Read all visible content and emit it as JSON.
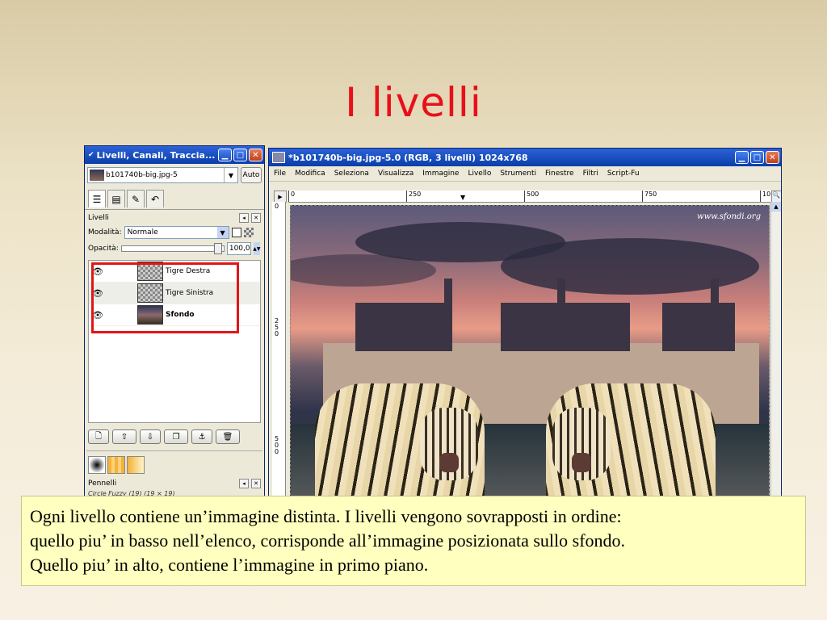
{
  "slide": {
    "title": "I livelli",
    "caption_lines": [
      "Ogni livello contiene un’immagine distinta. I livelli vengono sovrapposti in ordine:",
      "quello piu’ in basso nell’elenco, corrisponde all’immagine posizionata sullo sfondo.",
      "Quello piu’ in alto, contiene l’immagine in primo piano."
    ]
  },
  "dock": {
    "title": "Livelli, Canali, Traccia...",
    "image_select": "b101740b-big.jpg-5",
    "auto_label": "Auto",
    "panel_title": "Livelli",
    "mode_label": "Modalità:",
    "mode_value": "Normale",
    "opacity_label": "Opacità:",
    "opacity_value": "100,0",
    "opacity_fraction": 1.0,
    "layers": [
      {
        "name": "Tigre Destra",
        "visible": true,
        "bold": false
      },
      {
        "name": "Tigre Sinistra",
        "visible": true,
        "bold": false
      },
      {
        "name": "Sfondo",
        "visible": true,
        "bold": true
      }
    ],
    "brushes_title": "Pennelli",
    "brush_name": "Circle Fuzzy (19) (19 × 19)"
  },
  "image_window": {
    "title": "*b101740b-big.jpg-5.0 (RGB, 3 livelli) 1024x768",
    "menu": [
      "File",
      "Modifica",
      "Seleziona",
      "Visualizza",
      "Immagine",
      "Livello",
      "Strumenti",
      "Finestre",
      "Filtri",
      "Script-Fu"
    ],
    "ruler_top": [
      "0",
      "250",
      "500",
      "750",
      "10"
    ],
    "ruler_left": [
      "0",
      "250",
      "500"
    ],
    "watermark": "www.sfondi.org"
  },
  "colors": {
    "title_red": "#e8101a",
    "highlight_red": "#e21515",
    "caption_bg": "#ffffbf",
    "xp_blue": "#0a3ea8"
  }
}
